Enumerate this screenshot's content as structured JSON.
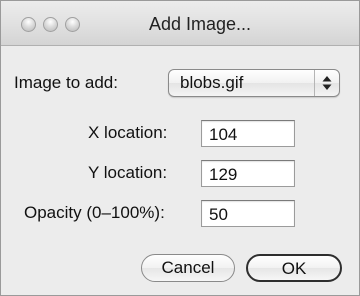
{
  "window": {
    "title": "Add Image..."
  },
  "form": {
    "image_label": "Image to add:",
    "image_selected": "blobs.gif",
    "x_label": "X location:",
    "x_value": "104",
    "y_label": "Y location:",
    "y_value": "129",
    "opacity_label": "Opacity (0–100%):",
    "opacity_value": "50"
  },
  "buttons": {
    "cancel_label": "Cancel",
    "ok_label": "OK"
  }
}
